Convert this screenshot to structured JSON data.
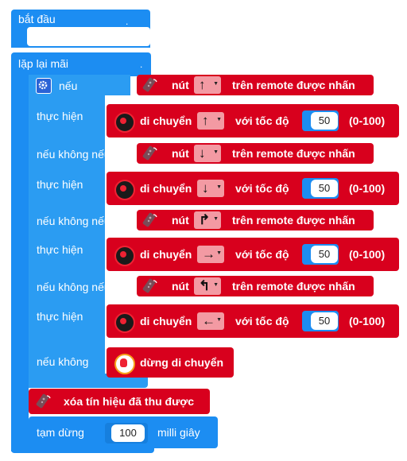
{
  "blocks": {
    "start": "bắt đầu",
    "forever": "lặp lại mãi",
    "if": "nếu",
    "do": "thực hiện",
    "else_if": "nếu không nếu",
    "else": "nếu không",
    "button_prefix": "nút",
    "button_suffix": "trên remote được nhấn",
    "move": "di chuyển",
    "speed_prefix": "với tốc độ",
    "range": "(0-100)",
    "stop": "dừng di chuyển",
    "clear": "xóa tín hiệu đã thu được",
    "pause": "tạm dừng",
    "pause_unit": "milli giây"
  },
  "conditions": [
    {
      "button_arrow": "↑"
    },
    {
      "button_arrow": "↓"
    },
    {
      "button_arrow": "↱"
    },
    {
      "button_arrow": "↰"
    }
  ],
  "actions": [
    {
      "direction": "↑",
      "speed": "50"
    },
    {
      "direction": "↓",
      "speed": "50"
    },
    {
      "direction": "→",
      "speed": "50"
    },
    {
      "direction": "←",
      "speed": "50"
    }
  ],
  "pause_value": "100",
  "colors": {
    "control": "#1c8df2",
    "remote": "#d8001d",
    "dropdown": "#f39aa3"
  }
}
